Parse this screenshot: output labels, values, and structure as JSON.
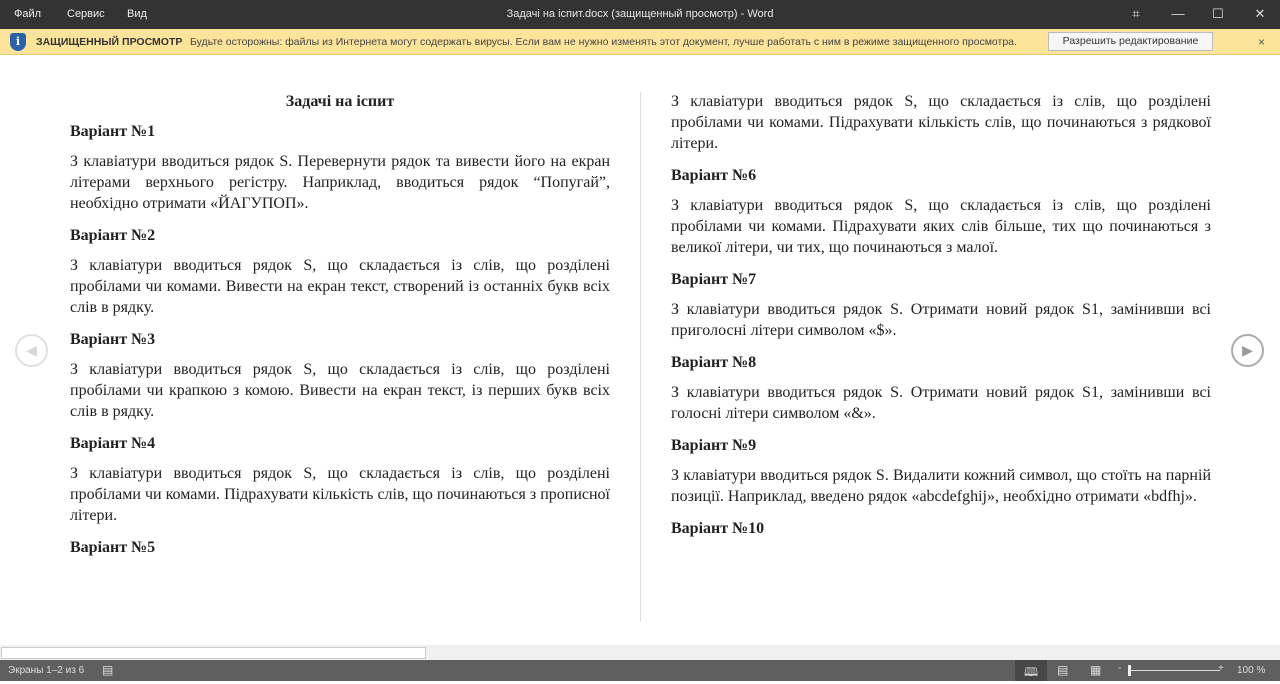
{
  "titlebar": {
    "menu": [
      "Файл",
      "Сервис",
      "Вид"
    ],
    "title": "Задачі на іспит.docx (защищенный просмотр)  -  Word"
  },
  "protected_view": {
    "label": "ЗАЩИЩЕННЫЙ ПРОСМОТР",
    "message": "Будьте осторожны: файлы из Интернета могут содержать вирусы. Если вам не нужно изменять этот документ, лучше работать с ним в режиме защищенного просмотра.",
    "enable_button": "Разрешить редактирование",
    "close": "×"
  },
  "document": {
    "title": "Задачі на іспит",
    "left": [
      {
        "h": "Варіант №1",
        "p": "З клавіатури вводиться рядок S. Перевернути рядок та вивести його на екран літерами верхнього регістру. Наприклад, вводиться рядок “Попугай”, необхідно отримати «ЙАГУПОП»."
      },
      {
        "h": "Варіант №2",
        "p": "З клавіатури вводиться рядок S, що складається із слів, що розділені пробілами чи комами. Вивести на екран текст, створений із останніх букв всіх слів в рядку."
      },
      {
        "h": "Варіант №3",
        "p": "З клавіатури вводиться рядок S, що складається із слів, що розділені пробілами чи крапкою з комою. Вивести на екран текст, із перших букв всіх слів в рядку."
      },
      {
        "h": "Варіант №4",
        "p": "З клавіатури вводиться рядок S, що складається із слів, що розділені пробілами чи комами. Підрахувати кількість слів, що починаються з прописної літери."
      },
      {
        "h": "Варіант №5",
        "p": ""
      }
    ],
    "right_intro": "З клавіатури вводиться рядок S, що складається із слів, що розділені пробілами чи комами. Підрахувати кількість слів, що починаються з рядкової літери.",
    "right": [
      {
        "h": "Варіант №6",
        "p": "З клавіатури вводиться рядок S, що складається із слів, що розділені пробілами чи комами. Підрахувати яких слів більше, тих що починаються з великої літери, чи тих, що починаються з малої."
      },
      {
        "h": "Варіант №7",
        "p": "З клавіатури вводиться рядок S. Отримати новий рядок S1, замінивши всі приголосні літери символом «$»."
      },
      {
        "h": "Варіант №8",
        "p": "З клавіатури вводиться рядок S. Отримати новий рядок S1, замінивши всі голосні літери символом «&»."
      },
      {
        "h": "Варіант №9",
        "p": "З клавіатури вводиться рядок S. Видалити кожний символ, що стоїть на парній позиції. Наприклад, введено рядок «abcdefghij», необхідно отримати «bdfhj»."
      },
      {
        "h": "Варіант №10",
        "p": ""
      }
    ]
  },
  "statusbar": {
    "pages": "Экраны 1–2 из 6",
    "zoom": "100 %",
    "zoom_percent": 100
  }
}
